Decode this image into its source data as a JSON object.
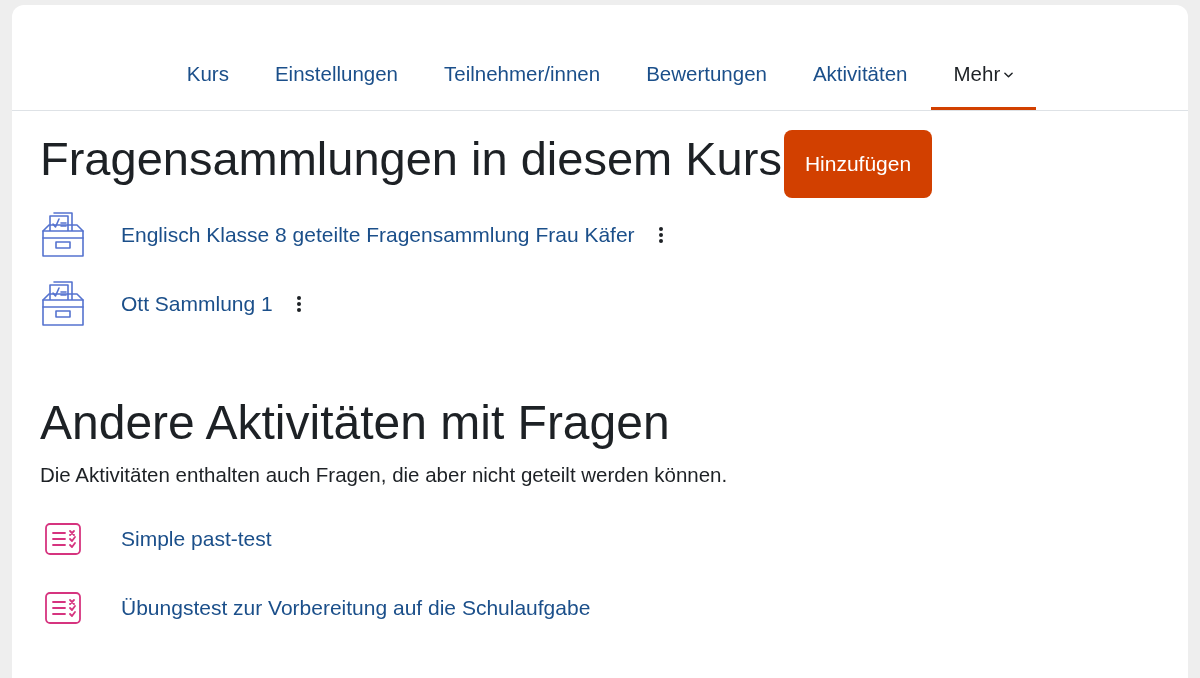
{
  "nav": {
    "tabs": [
      {
        "label": "Kurs",
        "selected": false,
        "kind": "link"
      },
      {
        "label": "Einstellungen",
        "selected": false,
        "kind": "link"
      },
      {
        "label": "Teilnehmer/innen",
        "selected": false,
        "kind": "link"
      },
      {
        "label": "Bewertungen",
        "selected": false,
        "kind": "link"
      },
      {
        "label": "Aktivitäten",
        "selected": false,
        "kind": "link"
      },
      {
        "label": "Mehr",
        "selected": true,
        "kind": "dropdown"
      }
    ]
  },
  "question_banks": {
    "heading": "Fragensammlungen in diesem Kurs",
    "add_button": "Hinzufügen",
    "items": [
      {
        "title": "Englisch Klasse 8 geteilte Fragensammlung Frau Käfer"
      },
      {
        "title": "Ott Sammlung 1"
      }
    ]
  },
  "other_activities": {
    "heading": "Andere Aktivitäten mit Fragen",
    "description": "Die Aktivitäten enthalten auch Fragen, die aber nicht geteilt werden können.",
    "items": [
      {
        "title": "Simple past-test"
      },
      {
        "title": "Übungstest zur Vorbereitung auf die Schulaufgabe"
      }
    ]
  }
}
